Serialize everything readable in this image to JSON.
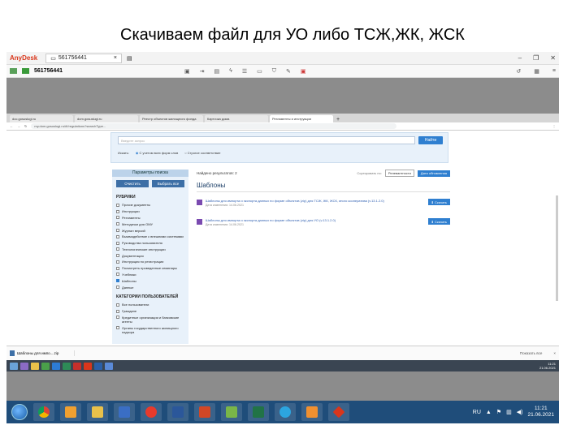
{
  "slide": {
    "title": "Скачиваем файл для УО либо ТСЖ,ЖК, ЖСК"
  },
  "anydesk": {
    "app_name": "AnyDesk",
    "session_tab": "561756441",
    "session_id": "561756441"
  },
  "browser": {
    "tabs": [
      {
        "label": "doc.gosuslugi.ru"
      },
      {
        "label": "dom.gosuslugi.ru"
      },
      {
        "label": "Реестр объектов жилищного фонда"
      },
      {
        "label": "Карточка дома"
      },
      {
        "label": "Регламенты и инструкции"
      }
    ],
    "url": "my.dom.gosuslugi.ru/#!/regulations?searchType..."
  },
  "search": {
    "placeholder": "Введите запрос",
    "button": "Найти",
    "mode_label": "Искать:",
    "option_forms": "С учетом всех форм слов",
    "option_exact": "Строгое соответствие"
  },
  "sidebar": {
    "header": "Параметры поиска",
    "clear_button": "Очистить",
    "select_all_button": "Выбрать все",
    "rubrics_title": "РУБРИКИ",
    "rubrics": [
      {
        "label": "Прочие документы",
        "checked": false
      },
      {
        "label": "Инструкции",
        "checked": false
      },
      {
        "label": "Регламенты",
        "checked": false
      },
      {
        "label": "Методички для ОМУ",
        "checked": false
      },
      {
        "label": "Журнал версий",
        "checked": false
      },
      {
        "label": "Взаимодействие с внешними системами",
        "checked": false
      },
      {
        "label": "Руководства пользователя",
        "checked": false
      },
      {
        "label": "Технологические инструкции",
        "checked": false
      },
      {
        "label": "Документация",
        "checked": false
      },
      {
        "label": "Инструкция по регистрации",
        "checked": false
      },
      {
        "label": "Посмотреть проведенные семинары",
        "checked": false
      },
      {
        "label": "Учебники",
        "checked": false
      },
      {
        "label": "Шаблоны",
        "checked": true
      },
      {
        "label": "Данные",
        "checked": false
      }
    ],
    "users_title": "КАТЕГОРИИ ПОЛЬЗОВАТЕЛЕЙ",
    "users": [
      {
        "label": "Все пользователи"
      },
      {
        "label": "Граждане"
      },
      {
        "label": "Кредитные организации и банковские агенты"
      },
      {
        "label": "Органы государственного жилищного надзора"
      }
    ]
  },
  "results": {
    "found": "Найдено результатов: 2",
    "sort_label": "Сортировать по:",
    "sort_value": "Релевантности",
    "new_button": "Дата обновления",
    "title": "Шаблоны",
    "items": [
      {
        "link": "Шаблоны для импорта и экспорта данных по форме объектов (zip) для ТСЖ, ЖК, ЖСК, иного кооператива (v.13.1.2.0)",
        "date": "Дата изменения: 14.06.2021",
        "button": "Скачать"
      },
      {
        "link": "Шаблоны для импорта и экспорта данных по форме объектов (zip) для УО (v.13.1.2.0)",
        "date": "Дата изменения: 14.06.2021",
        "button": "Скачать"
      }
    ]
  },
  "download": {
    "file": "Шаблоны для импо....zip",
    "show_all": "Показать все"
  },
  "remote_taskbar": {
    "time": "11:21",
    "date": "21.06.2021",
    "lang": "RU"
  },
  "local_taskbar": {
    "lang": "RU",
    "time": "11:21",
    "date": "21.06.2021"
  },
  "colors": {
    "accent": "#2f7fd0",
    "sidebar_bg": "#e8f1fa",
    "taskbar": "#1f4d7a"
  }
}
